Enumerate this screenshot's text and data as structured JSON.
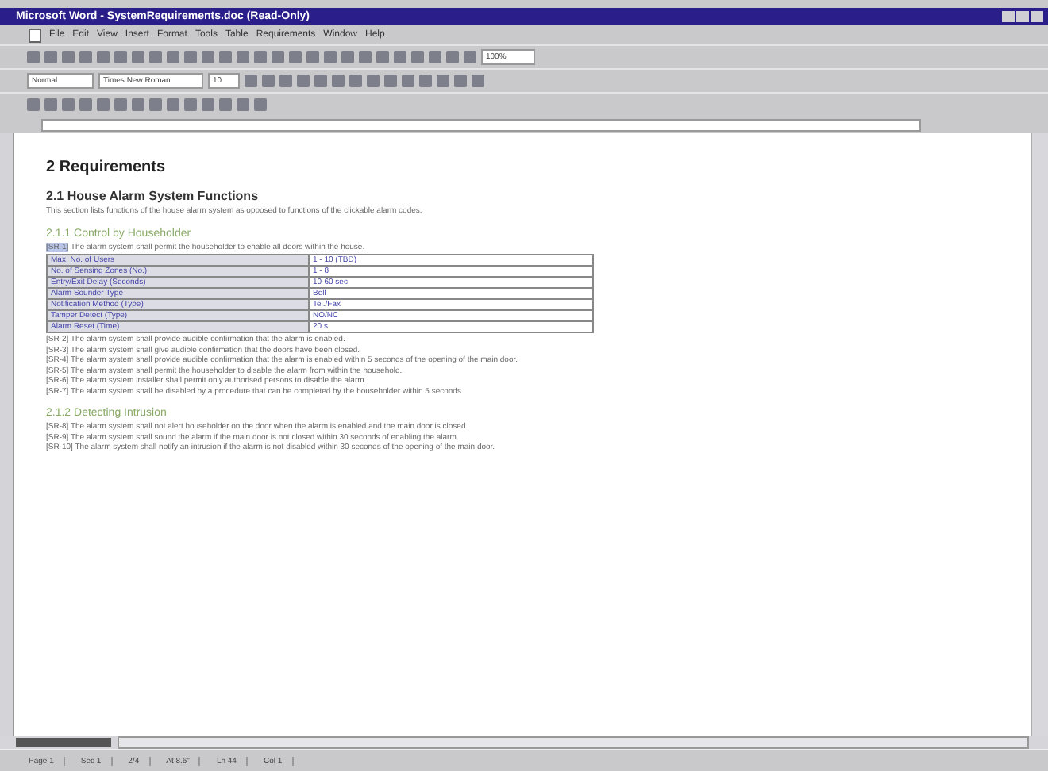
{
  "window": {
    "title": "Microsoft Word - SystemRequirements.doc (Read-Only)"
  },
  "menu": [
    "File",
    "Edit",
    "View",
    "Insert",
    "Format",
    "Tools",
    "Table",
    "Requirements",
    "Window",
    "Help"
  ],
  "toolbar": {
    "zoom": "100%",
    "style": "Normal",
    "font": "Times New Roman",
    "size": "10"
  },
  "document": {
    "heading": "2  Requirements",
    "section": {
      "title": "2.1  House Alarm System Functions",
      "intro": "This section lists functions of the house alarm system as opposed to functions of the clickable alarm codes."
    },
    "subsections": [
      {
        "title": "2.1.1  Control by Householder",
        "lead_tag": "[SR-1]",
        "lead": "The alarm system shall permit the householder to enable all doors within the house.",
        "table": [
          [
            "Max. No. of Users",
            "1 - 10 (TBD)"
          ],
          [
            "No. of Sensing Zones (No.)",
            "1 - 8"
          ],
          [
            "Entry/Exit Delay (Seconds)",
            "10-60 sec"
          ],
          [
            "Alarm Sounder Type",
            "Bell"
          ],
          [
            "Notification Method (Type)",
            "Tel./Fax"
          ],
          [
            "Tamper Detect (Type)",
            "NO/NC"
          ],
          [
            "Alarm Reset (Time)",
            "20 s"
          ]
        ],
        "requirements": [
          "[SR-2] The alarm system shall provide audible confirmation that the alarm is enabled.",
          "[SR-3] The alarm system shall give audible confirmation that the doors have been closed.",
          "[SR-4] The alarm system shall provide audible confirmation that the alarm is enabled within 5 seconds of the opening of the main door.",
          "[SR-5] The alarm system shall permit the householder to disable the alarm from within the household.",
          "[SR-6] The alarm system installer shall permit only authorised persons to disable the alarm.",
          "[SR-7] The alarm system shall be disabled by a procedure that can be completed by the householder within 5 seconds."
        ]
      },
      {
        "title": "2.1.2  Detecting Intrusion",
        "requirements": [
          "[SR-8] The alarm system shall not alert householder on the door when the alarm is enabled and the main door is closed.",
          "[SR-9] The alarm system shall sound the alarm if the main door is not closed within 30 seconds of enabling the alarm.",
          "[SR-10] The alarm system shall notify an intrusion if the alarm is not disabled within 30 seconds of the opening of the main door."
        ]
      }
    ]
  },
  "status_bar": [
    "Page 1",
    "Sec 1",
    "2/4",
    "At 8.6\"",
    "Ln 44",
    "Col 1"
  ]
}
